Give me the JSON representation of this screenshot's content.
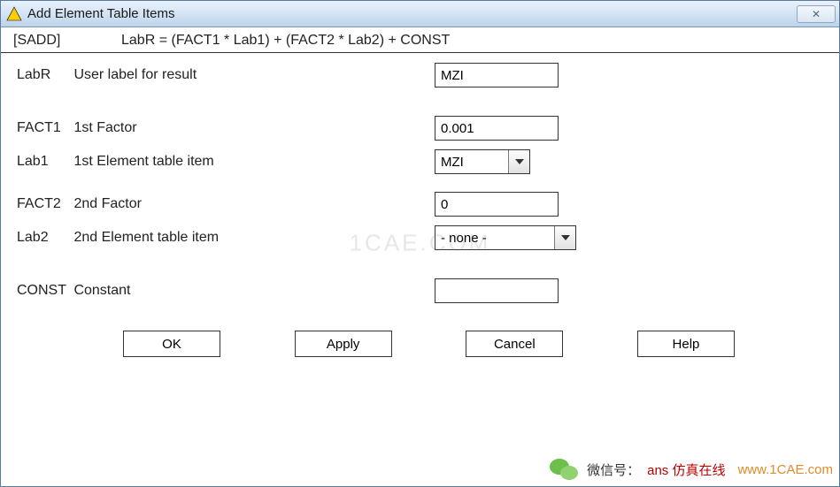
{
  "window": {
    "title": "Add Element Table Items",
    "close_glyph": "✕"
  },
  "formula": {
    "cmd": "[SADD]",
    "expr": "LabR = (FACT1 * Lab1) + (FACT2 * Lab2) + CONST"
  },
  "fields": {
    "labr": {
      "key": "LabR",
      "desc": "User label for result",
      "value": "MZI"
    },
    "fact1": {
      "key": "FACT1",
      "desc": "1st Factor",
      "value": "0.001"
    },
    "lab1": {
      "key": "Lab1",
      "desc": "1st Element table item",
      "value": "MZI"
    },
    "fact2": {
      "key": "FACT2",
      "desc": "2nd Factor",
      "value": "0"
    },
    "lab2": {
      "key": "Lab2",
      "desc": "2nd Element table item",
      "value": "- none -"
    },
    "const": {
      "key": "CONST",
      "desc": "Constant",
      "value": ""
    }
  },
  "buttons": {
    "ok": "OK",
    "apply": "Apply",
    "cancel": "Cancel",
    "help": "Help"
  },
  "watermark": {
    "center": "1CAE.COM",
    "overlay_label": "微信号：",
    "overlay_name": "ans 仿真在线",
    "overlay_url": "www.1CAE.com"
  }
}
